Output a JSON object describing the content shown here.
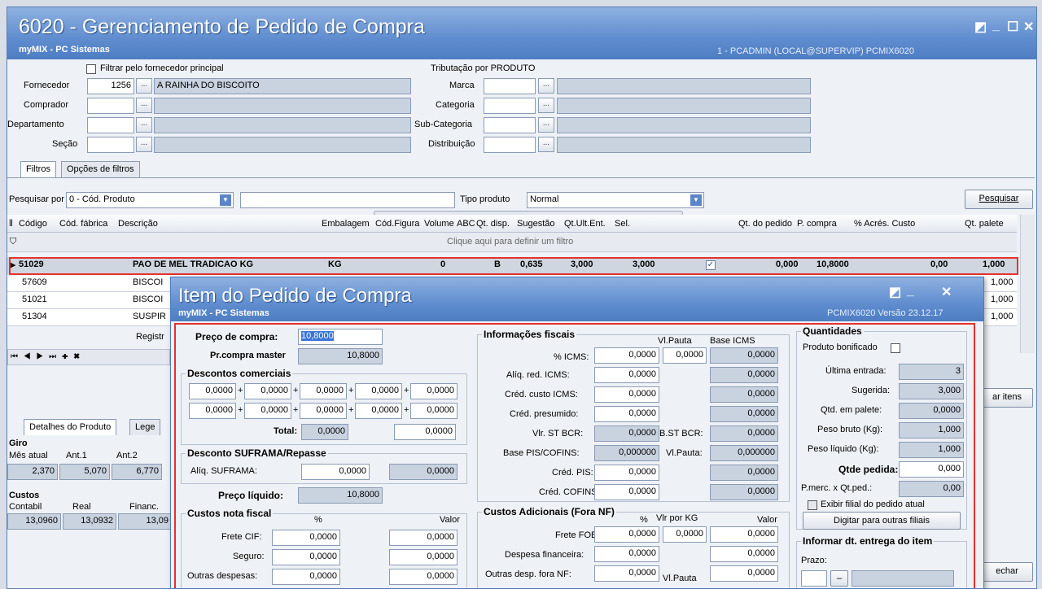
{
  "window": {
    "title": "6020 - Gerenciamento de Pedido de Compra",
    "subtitle": "myMIX - PC Sistemas",
    "user_info": "1 - PCADMIN (LOCAL@SUPERVIP)   PCMIX6020"
  },
  "filters": {
    "filtrar_fornecedor_label": "Filtrar pelo fornecedor principal",
    "tributacao_label": "Tributação por PRODUTO",
    "fornecedor_label": "Fornecedor",
    "fornecedor_code": "1256",
    "fornecedor_name": "A RAINHA DO BISCOITO",
    "comprador_label": "Comprador",
    "departamento_label": "Departamento",
    "secao_label": "Seção",
    "marca_label": "Marca",
    "categoria_label": "Categoria",
    "subcategoria_label": "Sub-Categoria",
    "distribuicao_label": "Distribuição",
    "ellipsis": "...",
    "tabs": [
      "Filtros",
      "Opções de filtros"
    ],
    "pesquisar_por_label": "Pesquisar por",
    "pesquisar_por_value": "0 - Cód. Produto",
    "tipo_produto_label": "Tipo produto",
    "tipo_produto_value": "Normal",
    "pesquisar_button": "Pesquisar"
  },
  "grid": {
    "columns": [
      "Código",
      "Cód. fábrica",
      "Descrição",
      "Embalagem",
      "Cód.Figura",
      "Volume",
      "ABC",
      "Qt. disp.",
      "Sugestão",
      "Qt.Ult.Ent.",
      "Sel.",
      "Qt. do pedido",
      "P. compra",
      "% Acrés. Custo",
      "Qt. palete"
    ],
    "filter_hint": "Clique aqui para definir um filtro",
    "rows": [
      {
        "codigo": "51029",
        "fabrica": "",
        "descricao": "PAO DE MEL TRADICAO KG",
        "embalagem": "KG",
        "volume": "0",
        "abc": "B",
        "qt_disp": "0,635",
        "sugestao": "3,000",
        "qt_ult": "3,000",
        "qt_pedido": "0,000",
        "p_compra": "10,8000",
        "acres": "0,00",
        "palete": "1,000"
      },
      {
        "codigo": "57609",
        "descricao": "BISCOI",
        "palete": "1,000"
      },
      {
        "codigo": "51021",
        "descricao": "BISCOI",
        "palete": "1,000"
      },
      {
        "codigo": "51304",
        "descricao": "SUSPIR",
        "palete": "1,000"
      }
    ],
    "registr_label": "Registr"
  },
  "bottom": {
    "tabs": [
      "Detalhes do Produto",
      "Lege"
    ],
    "giro_label": "Giro",
    "giro_cols": [
      "Mês atual",
      "Ant.1",
      "Ant.2"
    ],
    "giro_values": [
      "2,370",
      "5,070",
      "6,770"
    ],
    "custos_label": "Custos",
    "custos_cols": [
      "Contabil",
      "Real",
      "Financ."
    ],
    "custos_values": [
      "13,0960",
      "13,0932",
      "13,09"
    ],
    "itens_button": "ar itens",
    "fechar_button": "echar"
  },
  "dialog": {
    "title": "Item do Pedido de Compra",
    "subtitle": "myMIX - PC Sistemas",
    "version": "PCMIX6020   Versão 23.12.17",
    "preco_compra_label": "Preço de compra:",
    "preco_compra_value": "10,8000",
    "prcompra_master_label": "Pr.compra master",
    "prcompra_master_value": "10,8000",
    "descontos_label": "Descontos comerciais",
    "descontos_row1": [
      "0,0000",
      "0,0000",
      "0,0000",
      "0,0000",
      "0,0000"
    ],
    "descontos_row2": [
      "0,0000",
      "0,0000",
      "0,0000",
      "0,0000",
      "0,0000"
    ],
    "plus": "+",
    "total_label": "Total:",
    "total_value": "0,0000",
    "total_value2": "0,0000",
    "suframa_group_label": "Desconto SUFRAMA/Repasse",
    "aliq_suframa_label": "Alíq. SUFRAMA:",
    "aliq_suframa_value": "0,0000",
    "aliq_suframa_value2": "0,0000",
    "preco_liquido_label": "Preço líquido:",
    "preco_liquido_value": "10,8000",
    "custos_nf_label": "Custos nota fiscal",
    "pct_header": "%",
    "valor_header": "Valor",
    "frete_cif_label": "Frete CIF:",
    "frete_cif_pct": "0,0000",
    "frete_cif_val": "0,0000",
    "seguro_label": "Seguro:",
    "seguro_pct": "0,0000",
    "seguro_val": "0,0000",
    "outras_label": "Outras despesas:",
    "outras_pct": "0,0000",
    "outras_val": "0,0000",
    "info_fiscais_label": "Informações fiscais",
    "vlpauta_header": "Vl.Pauta",
    "base_icms_header": "Base ICMS",
    "icms_label": "% ICMS:",
    "icms_value": "0,0000",
    "icms_pauta": "0,0000",
    "icms_base": "0,0000",
    "aliq_red_label": "Alíq. red. ICMS:",
    "aliq_red_value": "0,0000",
    "aliq_red_base": "0,0000",
    "cred_custo_label": "Créd. custo ICMS:",
    "cred_custo_value": "0,0000",
    "cred_custo_base": "0,0000",
    "cred_presumido_label": "Créd. presumido:",
    "cred_presumido_value": "0,0000",
    "cred_presumido_base": "0,0000",
    "vlr_st_label": "Vlr. ST BCR:",
    "vlr_st_value": "0,0000",
    "bst_label": "B.ST BCR:",
    "bst_value": "0,0000",
    "base_pis_label": "Base PIS/COFINS:",
    "base_pis_value": "0,000000",
    "vlpauta_label": "Vl.Pauta:",
    "vlpauta_value": "0,000000",
    "cred_pis_label": "Créd. PIS:",
    "cred_pis_value": "0,0000",
    "cred_pis_base": "0,0000",
    "cred_cofins_label": "Créd. COFINS:",
    "cred_cofins_value": "0,0000",
    "cred_cofins_base": "0,0000",
    "custos_adic_label": "Custos Adicionais (Fora NF)",
    "adic_pct": "%",
    "vlr_kg_header": "Vlr por KG",
    "adic_valor_header": "Valor",
    "frete_fob_label": "Frete FOB:",
    "frete_fob_pct": "0,0000",
    "frete_fob_kg": "0,0000",
    "frete_fob_val": "0,0000",
    "desp_fin_label": "Despesa financeira:",
    "desp_fin_pct": "0,0000",
    "desp_fin_val": "0,0000",
    "outras_fora_label": "Outras desp. fora NF:",
    "outras_fora_pct": "0,0000",
    "outras_fora_val": "0,0000",
    "vlpauta2_label": "Vl.Pauta",
    "quantidades_label": "Quantidades",
    "produto_bonificado_label": "Produto bonificado",
    "ultima_entrada_label": "Última entrada:",
    "ultima_entrada_value": "3",
    "sugerida_label": "Sugerida:",
    "sugerida_value": "3,000",
    "qtd_palete_label": "Qtd. em palete:",
    "qtd_palete_value": "0,0000",
    "peso_bruto_label": "Peso bruto (Kg):",
    "peso_bruto_value": "1,000",
    "peso_liquido_label": "Peso líquido (Kg):",
    "peso_liquido_value": "1,000",
    "qtde_pedida_label": "Qtde pedida:",
    "qtde_pedida_value": "0,000",
    "pmerc_label": "P.merc. x Qt.ped.:",
    "pmerc_value": "0,00",
    "exibir_filial_label": "Exibir filial do pedido atual",
    "digitar_button": "Digitar para outras filiais",
    "informar_label": "Informar dt. entrega do item",
    "prazo_label": "Prazo:",
    "minus": "–"
  }
}
